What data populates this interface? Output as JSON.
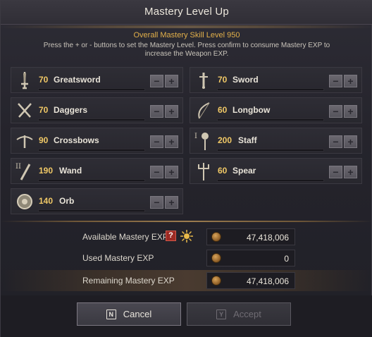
{
  "window": {
    "title": "Mastery Level Up",
    "overall_label": "Overall Mastery Skill Level 950",
    "instructions": "Press the + or - buttons to set the Mastery Level. Press confirm to consume Mastery EXP to increase the Weapon EXP."
  },
  "skills": [
    {
      "level": "70",
      "name": "Greatsword",
      "icon": "greatsword-icon"
    },
    {
      "level": "70",
      "name": "Sword",
      "icon": "sword-icon"
    },
    {
      "level": "70",
      "name": "Daggers",
      "icon": "daggers-icon"
    },
    {
      "level": "60",
      "name": "Longbow",
      "icon": "longbow-icon"
    },
    {
      "level": "90",
      "name": "Crossbows",
      "icon": "crossbow-icon"
    },
    {
      "level": "200",
      "name": "Staff",
      "icon": "staff-icon",
      "badge": "I"
    },
    {
      "level": "190",
      "name": "Wand",
      "icon": "wand-icon",
      "badge": "II"
    },
    {
      "level": "60",
      "name": "Spear",
      "icon": "spear-icon"
    },
    {
      "level": "140",
      "name": "Orb",
      "icon": "orb-icon"
    }
  ],
  "stepper": {
    "minus": "−",
    "plus": "+"
  },
  "exp": {
    "available_label": "Available Mastery EXP",
    "available_value": "47,418,006",
    "used_label": "Used Mastery EXP",
    "used_value": "0",
    "remaining_label": "Remaining Mastery EXP",
    "remaining_value": "47,418,006",
    "help": "?"
  },
  "buttons": {
    "cancel_key": "N",
    "cancel_label": "Cancel",
    "accept_key": "Y",
    "accept_label": "Accept"
  },
  "colors": {
    "accent_gold": "#e2b04a",
    "level_gold": "#f0c866",
    "help_red": "#9b2a24"
  }
}
